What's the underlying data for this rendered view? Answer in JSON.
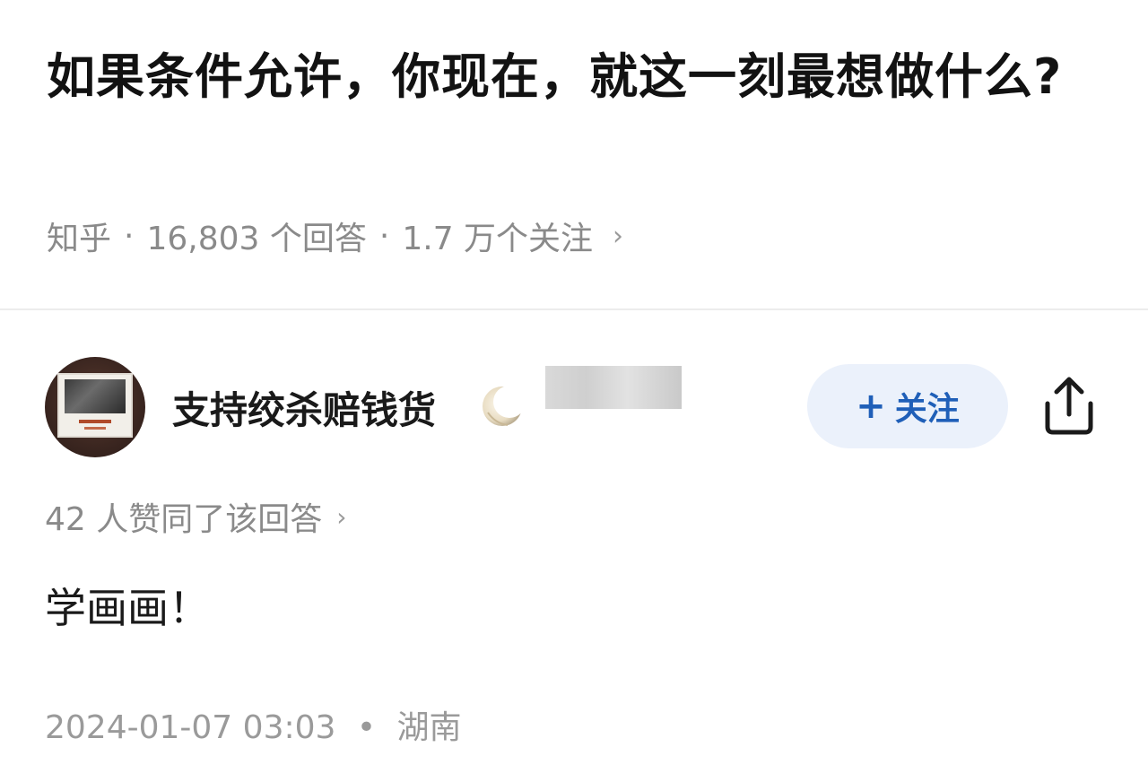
{
  "question": {
    "title": "如果条件允许，你现在，就这一刻最想做什么?",
    "source": "知乎",
    "separator": "·",
    "answer_count": "16,803 个回答",
    "follower_count": "1.7 万个关注",
    "chevron": "›"
  },
  "answer": {
    "author_name": "支持绞杀赔钱货",
    "follow_label": "关注",
    "follow_plus": "+",
    "likes_text": "42 人赞同了该回答",
    "likes_chevron": "›",
    "content": "学画画！",
    "date": "2024-01-07 03:03",
    "date_separator": "•",
    "location": "湖南"
  },
  "icons": {
    "share": "share-icon",
    "badge": "moon-badge-icon",
    "avatar": "avatar-image"
  },
  "colors": {
    "follow_bg": "#ebf1fb",
    "follow_text": "#1f5fb8",
    "meta_gray": "#8a8a8a",
    "title_text": "#121212"
  }
}
